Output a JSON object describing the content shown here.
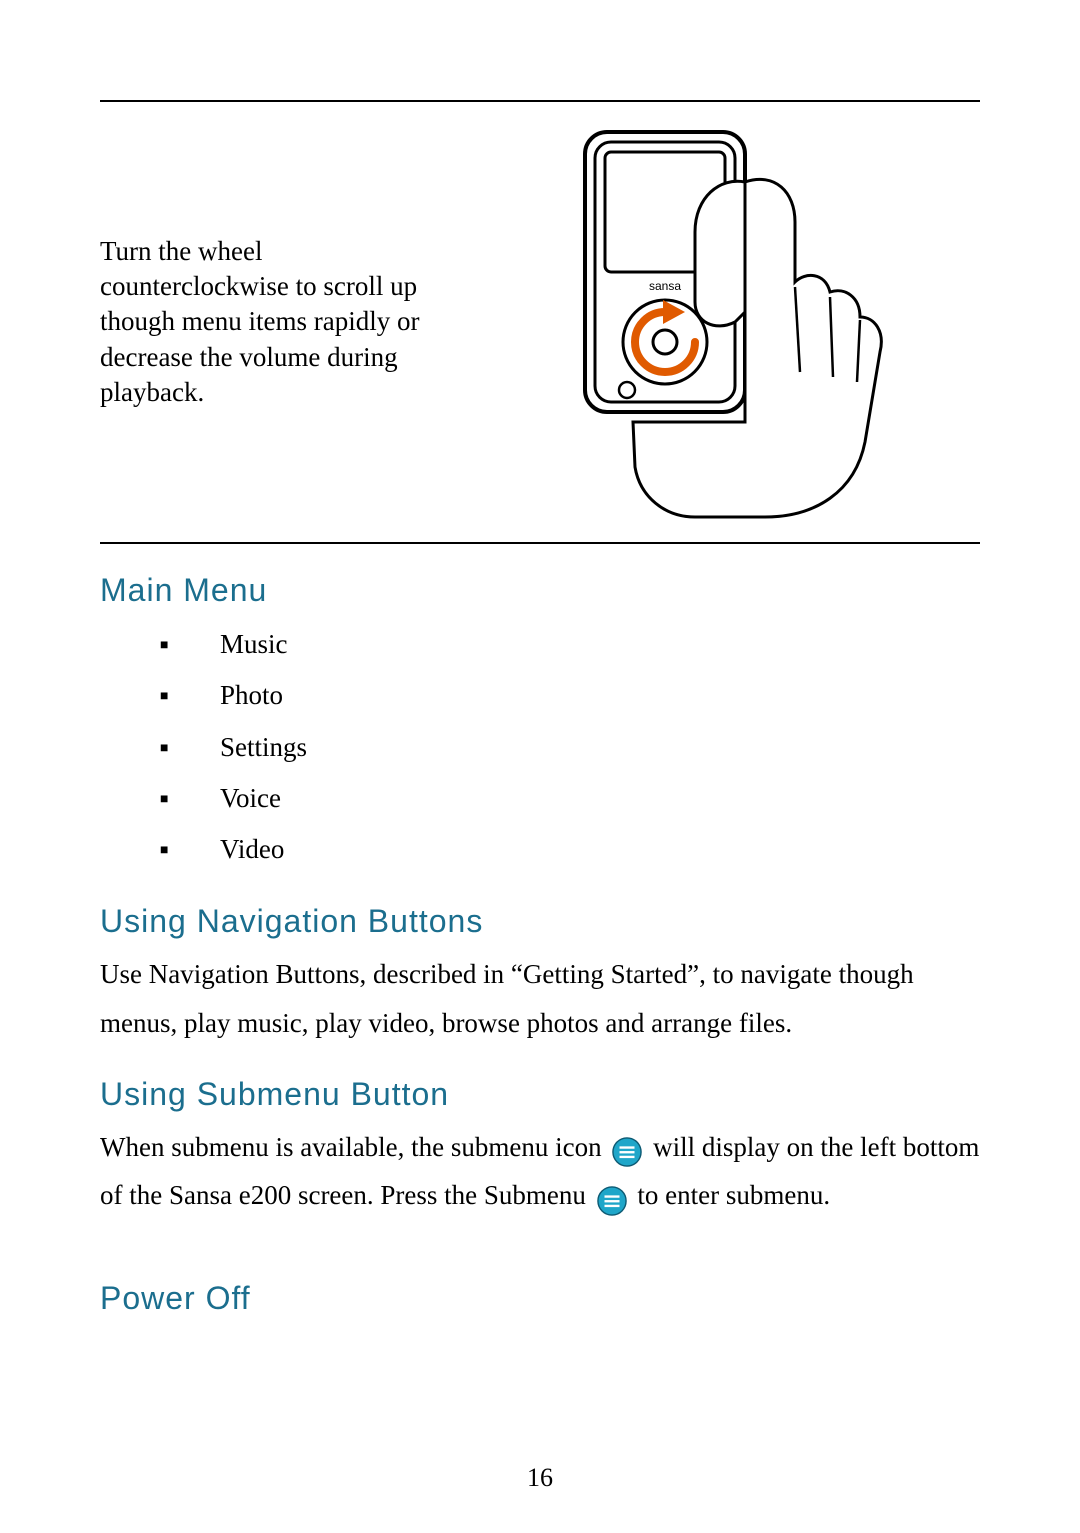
{
  "intro_paragraph": "Turn the wheel counterclockwise to scroll up though menu items rapidly or decrease the volume during playback.",
  "device_label": "sansa",
  "section_main_menu": {
    "heading": "Main Menu",
    "items": [
      "Music",
      "Photo",
      "Settings",
      "Voice",
      "Video"
    ]
  },
  "section_nav_buttons": {
    "heading": "Using Navigation Buttons",
    "body": "Use Navigation Buttons, described in “Getting Started”, to navigate though menus, play music, play video, browse photos and arrange files."
  },
  "section_submenu": {
    "heading": "Using Submenu Button",
    "body_part1": "When submenu is available, the submenu icon",
    "body_part2": " will display on the left bottom of the Sansa e200 screen. Press the Submenu",
    "body_part3": " to enter submenu."
  },
  "section_power_off": {
    "heading": "Power Off"
  },
  "page_number": "16",
  "colors": {
    "heading": "#1b6e8e",
    "icon_fill": "#1fa6c9",
    "icon_lines": "#ffffff",
    "arrow": "#e05a00"
  }
}
